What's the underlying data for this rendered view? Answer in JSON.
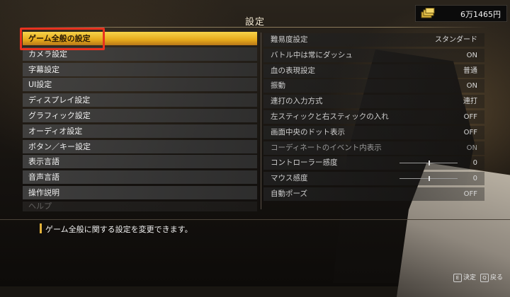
{
  "screen": {
    "title": "設定"
  },
  "money": {
    "amount": "6万1465円",
    "icon": "money-bundle-icon"
  },
  "menu": {
    "items": [
      {
        "label": "ゲーム全般の設定",
        "selected": true
      },
      {
        "label": "カメラ設定"
      },
      {
        "label": "字幕設定"
      },
      {
        "label": "UI設定"
      },
      {
        "label": "ディスプレイ設定"
      },
      {
        "label": "グラフィック設定"
      },
      {
        "label": "オーディオ設定"
      },
      {
        "label": "ボタン／キー設定"
      },
      {
        "label": "表示言語"
      },
      {
        "label": "音声言語"
      },
      {
        "label": "操作説明"
      },
      {
        "label": "ヘルプ"
      }
    ]
  },
  "settings": {
    "rows": [
      {
        "label": "難易度設定",
        "value": "スタンダード"
      },
      {
        "label": "バトル中は常にダッシュ",
        "value": "ON"
      },
      {
        "label": "血の表現設定",
        "value": "普通"
      },
      {
        "label": "振動",
        "value": "ON"
      },
      {
        "label": "連打の入力方式",
        "value": "連打"
      },
      {
        "label": "左スティックと右スティックの入れ",
        "value": "OFF"
      },
      {
        "label": "画面中央のドット表示",
        "value": "OFF"
      },
      {
        "label": "コーディネートのイベント内表示",
        "value": "ON"
      },
      {
        "label": "コントローラー感度",
        "value": "0",
        "slider": 0.5
      },
      {
        "label": "マウス感度",
        "value": "0",
        "slider": 0.5
      },
      {
        "label": "自動ポーズ",
        "value": "OFF"
      }
    ]
  },
  "description": {
    "text": "ゲーム全般に関する設定を変更できます。"
  },
  "hints": {
    "confirm_key": "E",
    "confirm_label": "決定",
    "back_key": "Q",
    "back_label": "戻る"
  },
  "colors": {
    "accent": "#e6a91b",
    "highlight_box": "#e8321f"
  }
}
